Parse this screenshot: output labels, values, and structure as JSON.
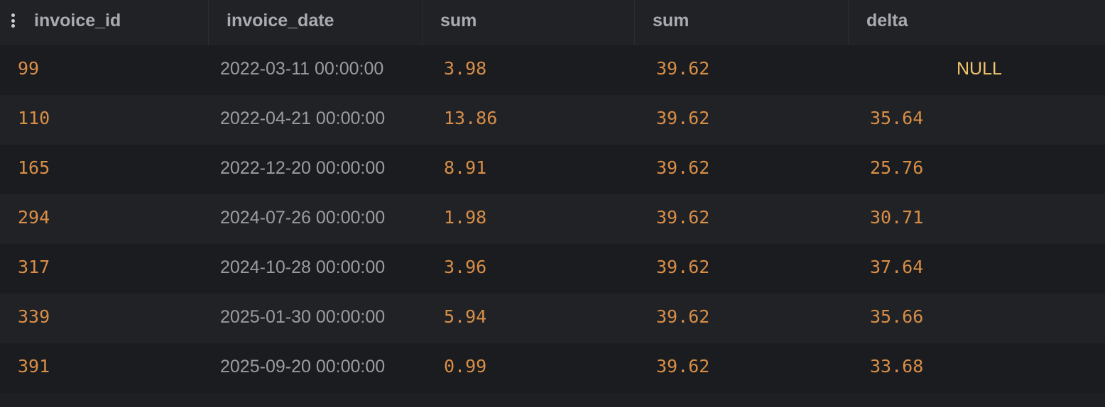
{
  "columns": [
    "invoice_id",
    "invoice_date",
    "sum",
    "sum",
    "delta"
  ],
  "rows": [
    {
      "invoice_id": "99",
      "invoice_date": "2022-03-11 00:00:00",
      "sum1": "3.98",
      "sum2": "39.62",
      "delta": "NULL"
    },
    {
      "invoice_id": "110",
      "invoice_date": "2022-04-21 00:00:00",
      "sum1": "13.86",
      "sum2": "39.62",
      "delta": "35.64"
    },
    {
      "invoice_id": "165",
      "invoice_date": "2022-12-20 00:00:00",
      "sum1": "8.91",
      "sum2": "39.62",
      "delta": "25.76"
    },
    {
      "invoice_id": "294",
      "invoice_date": "2024-07-26 00:00:00",
      "sum1": "1.98",
      "sum2": "39.62",
      "delta": "30.71"
    },
    {
      "invoice_id": "317",
      "invoice_date": "2024-10-28 00:00:00",
      "sum1": "3.96",
      "sum2": "39.62",
      "delta": "37.64"
    },
    {
      "invoice_id": "339",
      "invoice_date": "2025-01-30 00:00:00",
      "sum1": "5.94",
      "sum2": "39.62",
      "delta": "35.66"
    },
    {
      "invoice_id": "391",
      "invoice_date": "2025-09-20 00:00:00",
      "sum1": "0.99",
      "sum2": "39.62",
      "delta": "33.68"
    }
  ],
  "colors": {
    "background": "#1e1f22",
    "header_text": "#a8abb1",
    "number_text": "#d98e47",
    "date_text": "#9a9ca2",
    "null_text": "#f2c56d"
  },
  "icons": {
    "column_menu": "kebab-menu-icon"
  }
}
